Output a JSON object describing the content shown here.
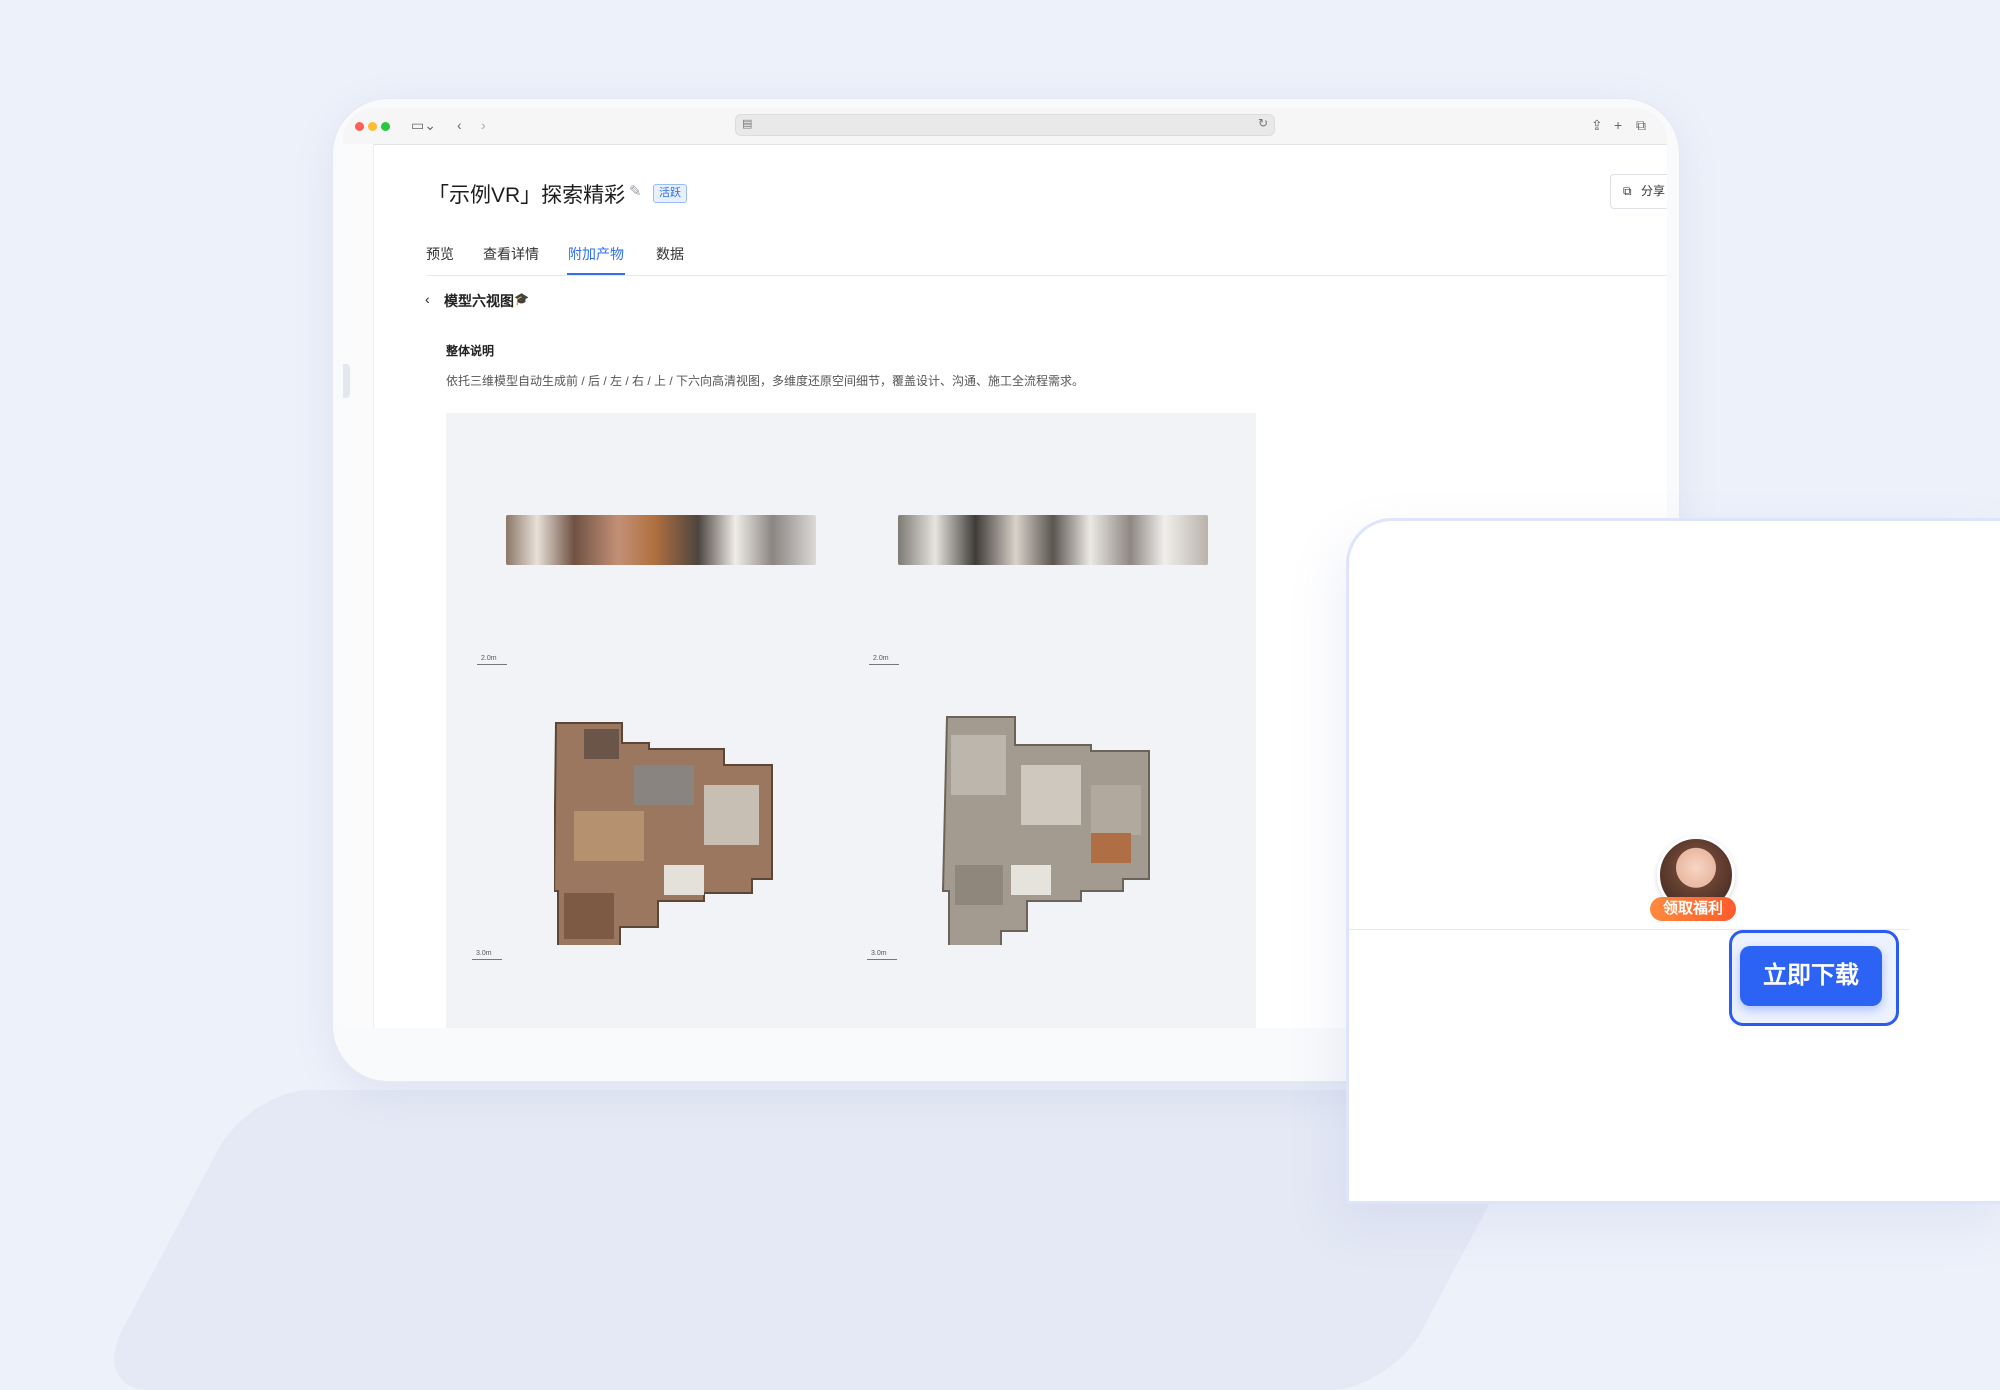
{
  "page": {
    "title": "「示例VR」探索精彩",
    "status_badge": "活跃",
    "share_label": "分享",
    "tabs": [
      {
        "label": "预览",
        "active": false
      },
      {
        "label": "查看详情",
        "active": false
      },
      {
        "label": "附加产物",
        "active": true
      },
      {
        "label": "数据",
        "active": false
      }
    ],
    "section_title": "模型六视图",
    "overview_title": "整体说明",
    "overview_text": "依托三维模型自动生成前 / 后 / 左 / 右 / 上 / 下六向高清视图，多维度还原空间细节，覆盖设计、沟通、施工全流程需求。",
    "scales": [
      "2.0m",
      "2.0m",
      "3.0m",
      "3.0m"
    ]
  },
  "icons": {
    "traffic_lights": [
      "#ff5f57",
      "#febc2e",
      "#28c840"
    ],
    "sidebar": "sidebar-toggle-icon",
    "back": "chevron-left-icon",
    "forward": "chevron-right-icon",
    "share_sys": "share-icon",
    "new_tab": "plus-icon",
    "tabs_overview": "tabs-icon",
    "edit": "edit-icon",
    "mortarboard": "graduation-cap-icon"
  },
  "promo": {
    "avatar_tag": "领取福利",
    "download_button": "立即下载"
  },
  "colors": {
    "accent": "#2f6ff0",
    "download": "#2d63f5",
    "tag": "#ff6a2f"
  }
}
